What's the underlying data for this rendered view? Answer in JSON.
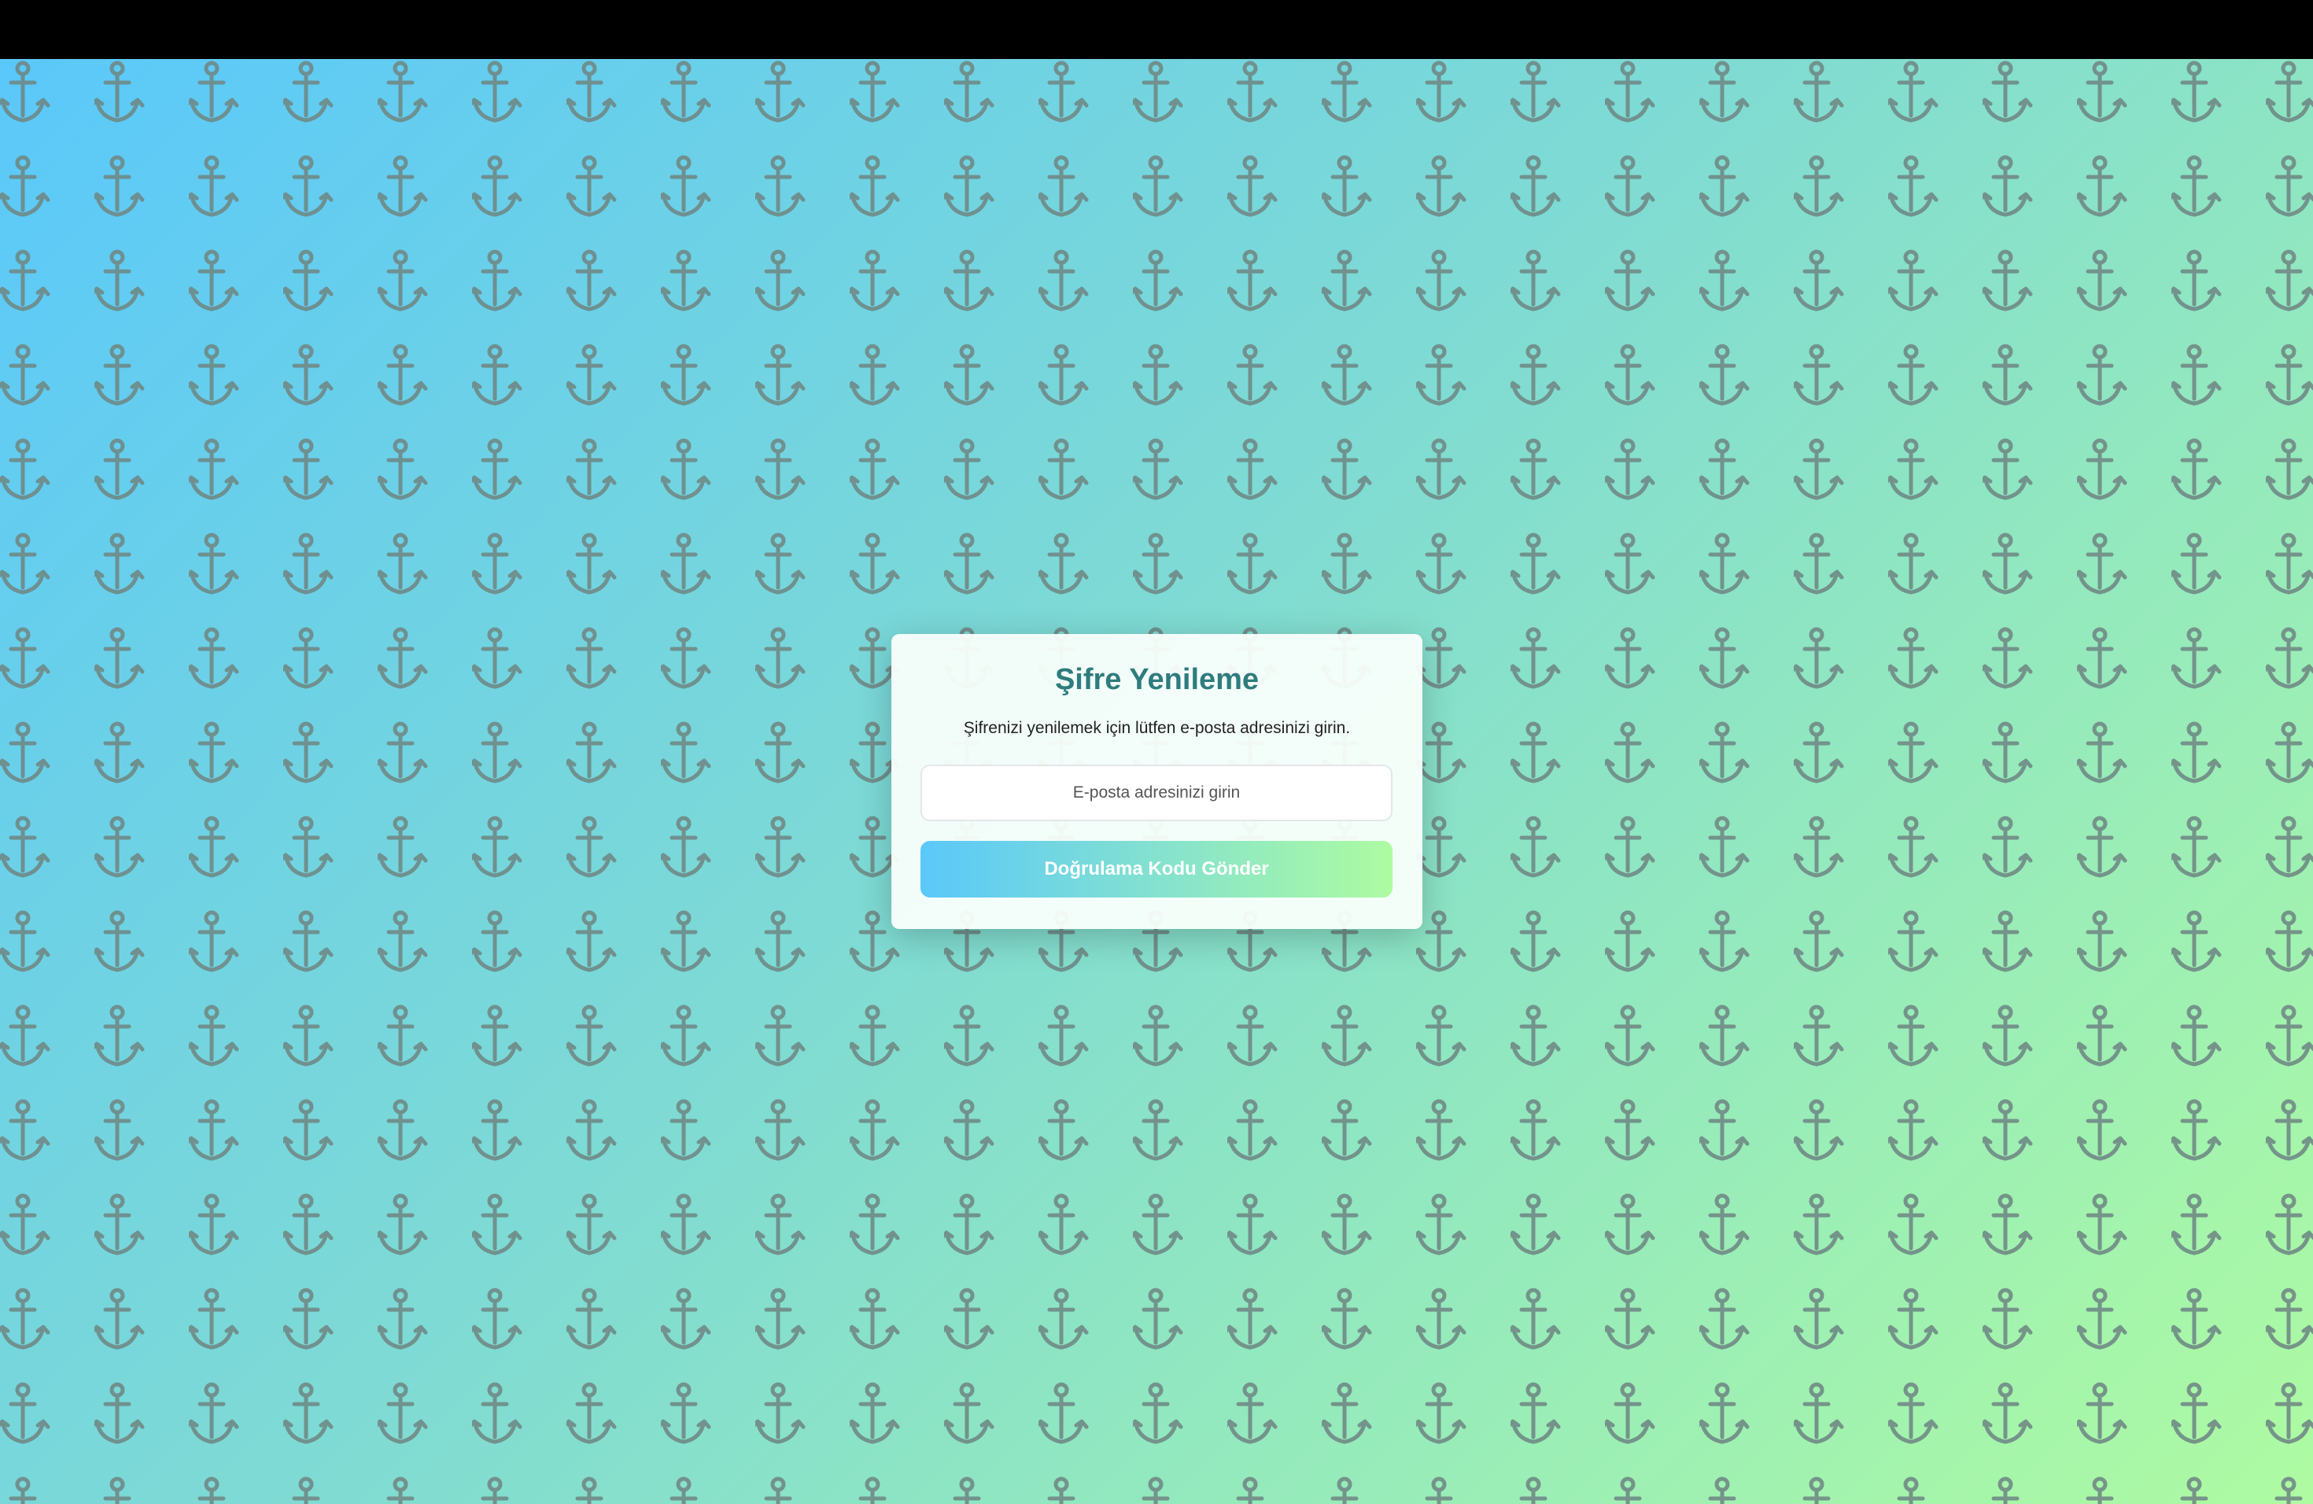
{
  "reset_card": {
    "title": "Şifre Yenileme",
    "description": "Şifrenizi yenilemek için lütfen e-posta adresinizi girin.",
    "email_input": {
      "placeholder": "E-posta adresinizi girin",
      "value": ""
    },
    "submit_label": "Doğrulama Kodu Gönder"
  },
  "background": {
    "pattern_icon": "anchor-icon",
    "gradient_colors": [
      "#5ac8fa",
      "#aefba2"
    ],
    "icon_color": "#6e8884"
  },
  "theme": {
    "title_color": "#2e7c7e"
  }
}
